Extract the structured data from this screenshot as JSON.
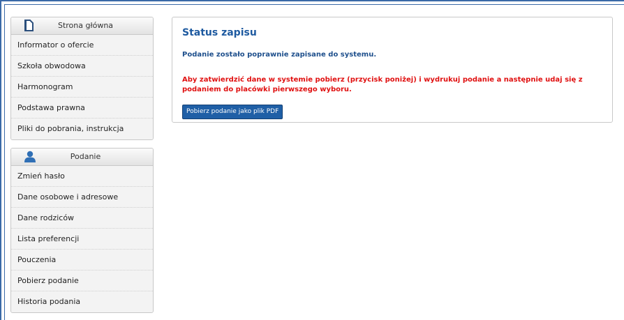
{
  "sidebar": {
    "main": {
      "title": "Strona główna",
      "icon": "document-icon",
      "items": [
        {
          "label": "Informator o ofercie"
        },
        {
          "label": "Szkoła obwodowa"
        },
        {
          "label": "Harmonogram"
        },
        {
          "label": "Podstawa prawna"
        },
        {
          "label": "Pliki do pobrania, instrukcja"
        }
      ]
    },
    "podanie": {
      "title": "Podanie",
      "icon": "user-icon",
      "items": [
        {
          "label": "Zmień hasło"
        },
        {
          "label": "Dane osobowe i adresowe"
        },
        {
          "label": "Dane rodziców"
        },
        {
          "label": "Lista preferencji"
        },
        {
          "label": "Pouczenia"
        },
        {
          "label": "Pobierz podanie"
        },
        {
          "label": "Historia podania"
        }
      ]
    }
  },
  "panel": {
    "title": "Status zapisu",
    "success_message": "Podanie zostało poprawnie zapisane do systemu.",
    "warning_message": "Aby zatwierdzić dane w systemie pobierz (przycisk poniżej) i wydrukuj podanie a następnie udaj się z podaniem do placówki pierwszego wyboru.",
    "download_button": "Pobierz podanie jako plik PDF"
  },
  "colors": {
    "accent": "#1e5aa0",
    "warning": "#e01010",
    "button": "#1f5fa6"
  }
}
